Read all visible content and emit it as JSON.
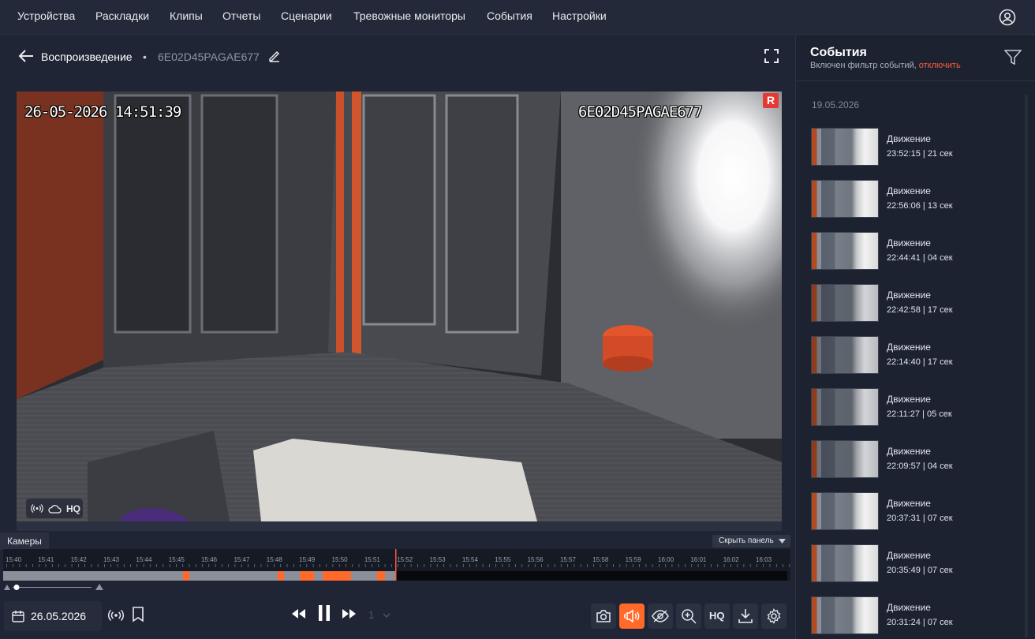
{
  "nav": {
    "items": [
      "Устройства",
      "Раскладки",
      "Клипы",
      "Отчеты",
      "Сценарии",
      "Тревожные мониторы",
      "События",
      "Настройки"
    ]
  },
  "header": {
    "section": "Воспроизведение",
    "separator": "•",
    "camera_id": "6E02D45PAGAE677"
  },
  "video": {
    "osd_datetime": "26-05-2026 14:51:39",
    "osd_camera": "6E02D45PAGAE677",
    "rec_badge": "R",
    "quality": "HQ"
  },
  "panel": {
    "cameras_tab": "Камеры",
    "hide_panel": "Скрыть панель"
  },
  "timeline": {
    "ticks": [
      "15:40",
      "15:41",
      "15:42",
      "15:43",
      "15:44",
      "15:45",
      "15:46",
      "15:47",
      "15:48",
      "15:49",
      "15:50",
      "15:51",
      "15:52",
      "15:53",
      "15:54",
      "15:55",
      "15:56",
      "15:57",
      "15:58",
      "15:59",
      "16:00",
      "16:01",
      "16:02",
      "16:03"
    ],
    "playhead": "15:52"
  },
  "controls": {
    "date": "26.05.2026",
    "speed": "1",
    "hq_label": "HQ"
  },
  "events_panel": {
    "title": "События",
    "filter_note": "Включен фильтр событий,",
    "filter_disable": "отключить",
    "date_group": "19.05.2026",
    "events": [
      {
        "type": "Движение",
        "time": "23:52:15",
        "duration": "21 сек"
      },
      {
        "type": "Движение",
        "time": "22:56:06",
        "duration": "13 сек"
      },
      {
        "type": "Движение",
        "time": "22:44:41",
        "duration": "04 сек"
      },
      {
        "type": "Движение",
        "time": "22:42:58",
        "duration": "17 сек"
      },
      {
        "type": "Движение",
        "time": "22:14:40",
        "duration": "17 сек"
      },
      {
        "type": "Движение",
        "time": "22:11:27",
        "duration": "05 сек"
      },
      {
        "type": "Движение",
        "time": "22:09:57",
        "duration": "04 сек"
      },
      {
        "type": "Движение",
        "time": "20:37:31",
        "duration": "07 сек"
      },
      {
        "type": "Движение",
        "time": "20:35:49",
        "duration": "07 сек"
      },
      {
        "type": "Движение",
        "time": "20:31:24",
        "duration": "07 сек"
      }
    ]
  },
  "colors": {
    "accent": "#ff6a2a",
    "link": "#ff5a3c",
    "background": "#1e2433"
  }
}
